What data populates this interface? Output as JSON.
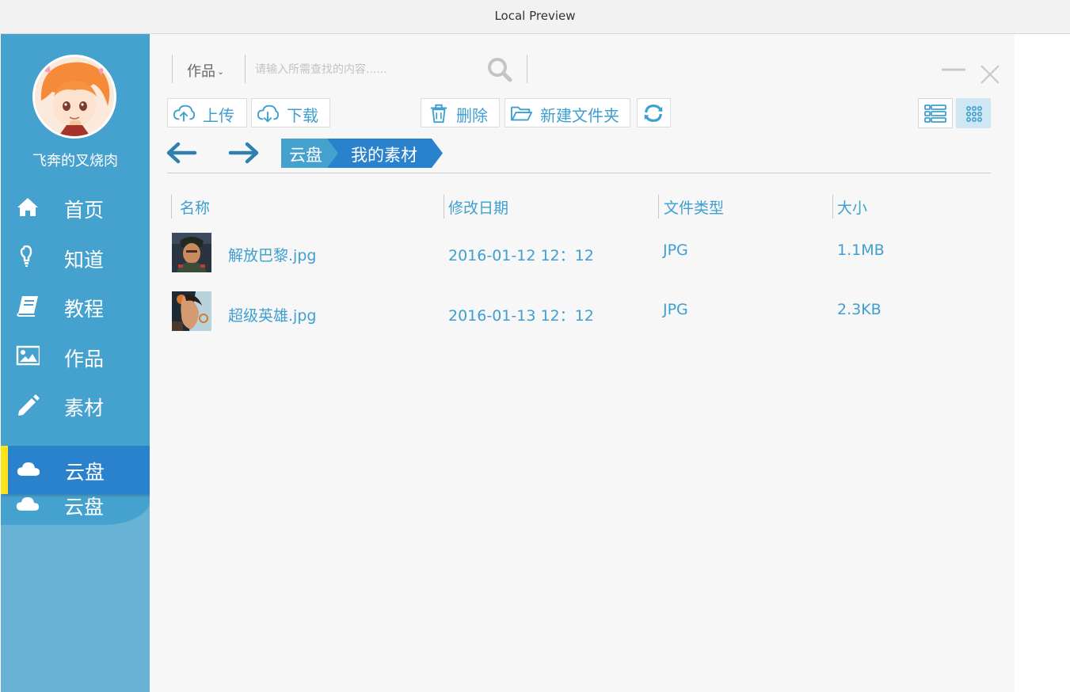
{
  "window": {
    "title": "Local Preview"
  },
  "sidebar": {
    "username": "飞奔的叉烧肉",
    "items": [
      {
        "label": "首页",
        "icon": "home-icon"
      },
      {
        "label": "知道",
        "icon": "lightbulb-icon"
      },
      {
        "label": "教程",
        "icon": "book-icon"
      },
      {
        "label": "作品",
        "icon": "image-icon"
      },
      {
        "label": "素材",
        "icon": "pencil-icon"
      },
      {
        "label": "云盘",
        "icon": "cloud-icon"
      }
    ],
    "active_item": {
      "label": "云盘",
      "icon": "cloud-icon"
    },
    "colors": {
      "background": "#45a1ce",
      "active": "#2a82cc",
      "active_marker": "#ffe31a"
    }
  },
  "search": {
    "scope": "作品",
    "placeholder": "请输入所需查找的内容......",
    "value": ""
  },
  "toolbar": {
    "upload": "上传",
    "download": "下载",
    "delete": "删除",
    "new_folder": "新建文件夹"
  },
  "breadcrumb": [
    "云盘",
    "我的素材"
  ],
  "table": {
    "headers": [
      "名称",
      "修改日期",
      "文件类型",
      "大小"
    ],
    "rows": [
      {
        "name": "解放巴黎.jpg",
        "date": "2016-01-12 12：12",
        "type": "JPG",
        "size": "1.1MB"
      },
      {
        "name": "超级英雄.jpg",
        "date": "2016-01-13 12：12",
        "type": "JPG",
        "size": "2.3KB"
      }
    ]
  },
  "colors": {
    "accent": "#3e9fd0",
    "panel": "#f7f7f7"
  }
}
